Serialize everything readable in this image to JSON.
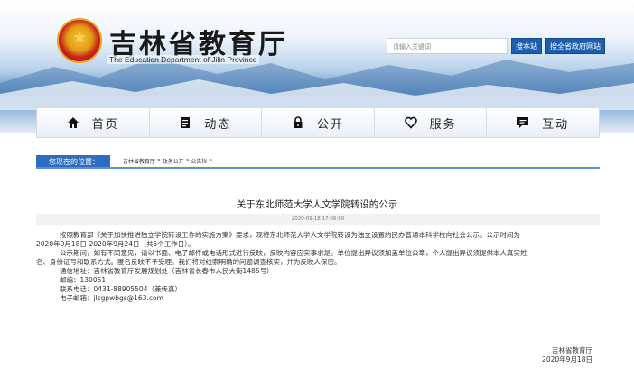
{
  "header": {
    "title": "吉林省教育厅",
    "subtitle": "The Education Department of Jilin Province",
    "search": {
      "placeholder": "请输入关键词",
      "site_button": "搜本站",
      "all_button": "搜全省政府网站"
    }
  },
  "nav": {
    "items": [
      {
        "label": "首页",
        "icon": "home-icon"
      },
      {
        "label": "动态",
        "icon": "document-icon"
      },
      {
        "label": "公开",
        "icon": "lock-icon"
      },
      {
        "label": "服务",
        "icon": "heart-icon"
      },
      {
        "label": "互动",
        "icon": "chat-icon"
      }
    ]
  },
  "breadcrumb": {
    "label": "您现在的位置：",
    "items": [
      "吉林省教育厅",
      "»",
      "政务公开",
      "»",
      "公告栏",
      "»"
    ]
  },
  "article": {
    "title": "关于东北师范大学人文学院转设的公示",
    "date": "2020-09-18 17:06:00",
    "para1_a": "按照教育部《关于加快推进独立学院转设工作的实施方案》要求，现将东北师范大学人文学院转设为独立设置的民办普通本科学校向社会公示。公示时间为",
    "para1_b": "2020年9月18日-2020年9月24日（共5个工作日）。",
    "para2_a": "公示期间，如有不同意见，请以书面、电子邮件或电话形式进行反映，反映内容应实事求是。单位提出异议须加盖单位公章，个人提出异议须提供本人真实姓",
    "para2_b": "名、身份证号和联系方式。匿名反映不予受理。我们将对线索明确的问题调查核实，并为反映人保密。",
    "address": "通信地址：吉林省教育厅发展规划处（吉林省长春市人民大街1485号）",
    "postcode": "邮编：130051",
    "phone": "联系电话：0431-88905504（兼传真）",
    "email": "电子邮箱：jlsgpwbgs@163.com",
    "signature_org": "吉林省教育厅",
    "signature_date": "2020年9月18日"
  },
  "colors": {
    "brand_blue": "#2d6cc0",
    "button_blue": "#1c5fb2",
    "emblem_red": "#c8201e"
  }
}
